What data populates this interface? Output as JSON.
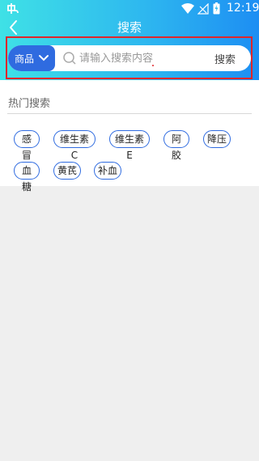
{
  "status_bar": {
    "time": "12:19",
    "icons": [
      "app-icon",
      "wifi-icon",
      "no-signal-icon",
      "battery-charging-icon"
    ]
  },
  "header": {
    "title": "搜索",
    "back_icon": "back-icon"
  },
  "search": {
    "category": "商品",
    "placeholder": "请输入搜索内容",
    "submit_label": "搜索",
    "highlight_color": "#e0262b",
    "accent_color": "#2f6be0"
  },
  "hot": {
    "title": "热门搜索",
    "tags": [
      "感冒",
      "维生素C",
      "维生素E",
      "阿胶",
      "降压",
      "血糖",
      "黄芪",
      "补血"
    ]
  }
}
